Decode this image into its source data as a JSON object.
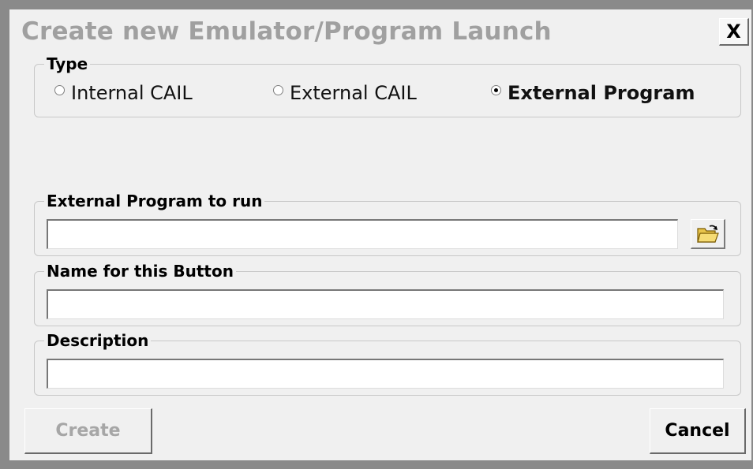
{
  "dialog": {
    "title": "Create new Emulator/Program Launch",
    "close_label": "X"
  },
  "type_group": {
    "legend": "Type",
    "options": [
      {
        "label": "Internal CAIL",
        "selected": false
      },
      {
        "label": "External CAIL",
        "selected": false
      },
      {
        "label": "External Program",
        "selected": true
      }
    ]
  },
  "program_group": {
    "legend": "External Program to run",
    "value": ""
  },
  "name_group": {
    "legend": "Name for this Button",
    "value": ""
  },
  "description_group": {
    "legend": "Description",
    "value": ""
  },
  "buttons": {
    "create": "Create",
    "cancel": "Cancel"
  },
  "icons": {
    "browse": "folder-open-icon"
  }
}
